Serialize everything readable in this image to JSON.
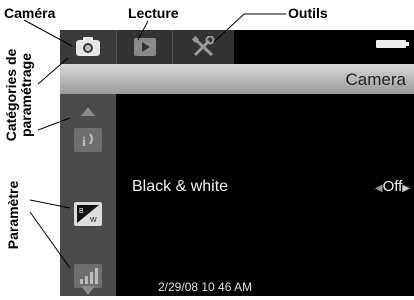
{
  "annotations": {
    "camera": "Caméra",
    "lecture": "Lecture",
    "outils": "Outils",
    "categories_line1": "Catégories de",
    "categories_line2": "paramétrage",
    "parametre": "Paramètre"
  },
  "tabs": {
    "camera_icon": "camera-icon",
    "playback_icon": "play-icon",
    "tools_icon": "tools-icon"
  },
  "header": {
    "title": "Camera"
  },
  "setting": {
    "label": "Black & white",
    "value": "Off",
    "left_arrow": "◀",
    "right_arrow": "▶"
  },
  "timestamp": "2/29/08 10 46 AM",
  "bw_icon": {
    "top": "B",
    "bottom": "W"
  },
  "colors": {
    "screen": "#000000",
    "subbar": "#b8b8b8",
    "sidebar": "#4a4a4a"
  }
}
